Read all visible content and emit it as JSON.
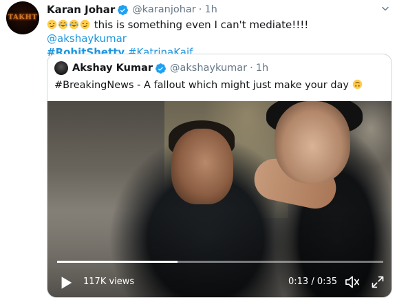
{
  "tweet": {
    "author_name": "Karan Johar",
    "author_handle": "@karanjohar",
    "separator": "·",
    "time": "1h",
    "avatar_text": "TAKHT",
    "text_main": " this is something even I can't mediate!!!! ",
    "mention": "@akshaykumar",
    "hashtag_bold": "#RohitShetty",
    "hashtag_2": "#KatrinaKaif",
    "emojis": [
      "smirking-face",
      "joy-face",
      "joy-face",
      "smirking-face"
    ]
  },
  "quoted_tweet": {
    "author_name": "Akshay Kumar",
    "author_handle": "@akshaykumar",
    "separator": "·",
    "time": "1h",
    "text": "#BreakingNews - A fallout which might just make your day ",
    "trailing_emoji": "upside-down-face"
  },
  "video": {
    "views": "117K views",
    "timecode": "0:13 / 0:35",
    "progress_fraction": 0.37
  },
  "colors": {
    "link": "#1b95e0",
    "verified": "#1da1f2",
    "secondary_text": "#657786"
  }
}
